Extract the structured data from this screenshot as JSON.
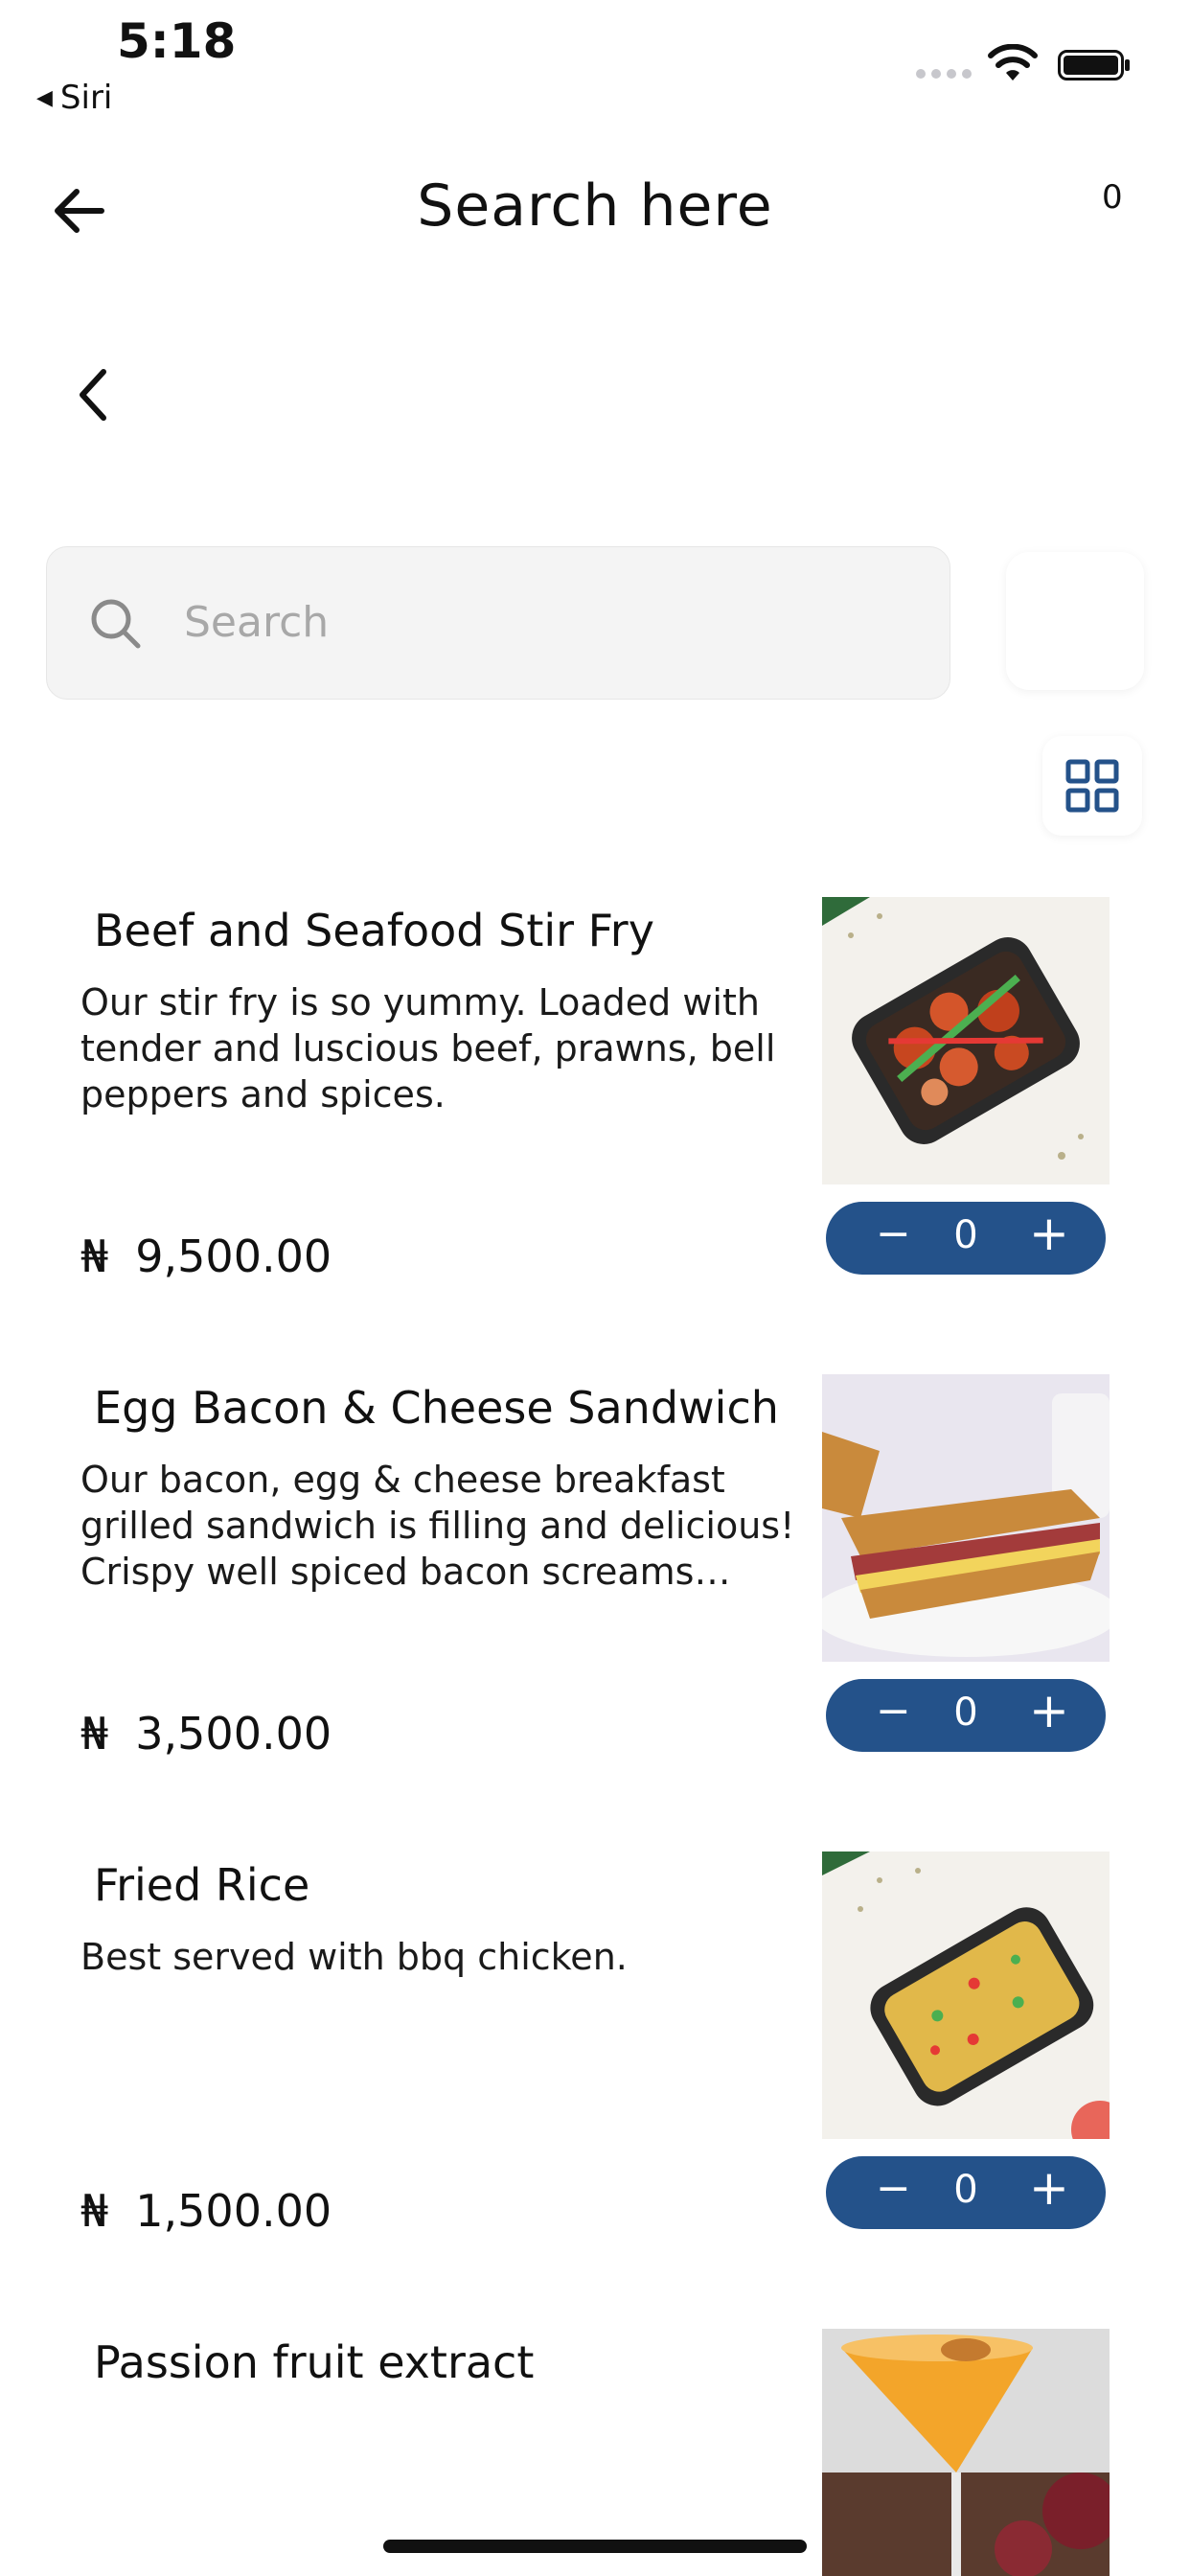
{
  "status_bar": {
    "time": "5:18",
    "back_app": "Siri"
  },
  "header": {
    "title": "Search here",
    "cart_count": "0"
  },
  "search": {
    "placeholder": "Search"
  },
  "colors": {
    "accent": "#24528a"
  },
  "products": [
    {
      "name": "Beef and Seafood Stir Fry",
      "description": "Our stir fry is so yummy. Loaded with tender and luscious beef, prawns, bell peppers and spices.",
      "currency": "₦",
      "price": "9,500.00",
      "quantity": "0",
      "image": "stir-fry-tray"
    },
    {
      "name": "Egg Bacon & Cheese Sandwich",
      "description": "Our bacon, egg & cheese breakfast grilled sandwich is filling and delicious! Crispy well spiced bacon screams delicious",
      "currency": "₦",
      "price": "3,500.00",
      "quantity": "0",
      "image": "grilled-sandwich"
    },
    {
      "name": "Fried Rice",
      "description": "Best served with bbq chicken.",
      "currency": "₦",
      "price": "1,500.00",
      "quantity": "0",
      "image": "fried-rice-tray"
    },
    {
      "name": "Passion fruit extract",
      "image": "passion-fruit-cocktail"
    }
  ],
  "stepper": {
    "minus": "−",
    "plus": "+"
  }
}
